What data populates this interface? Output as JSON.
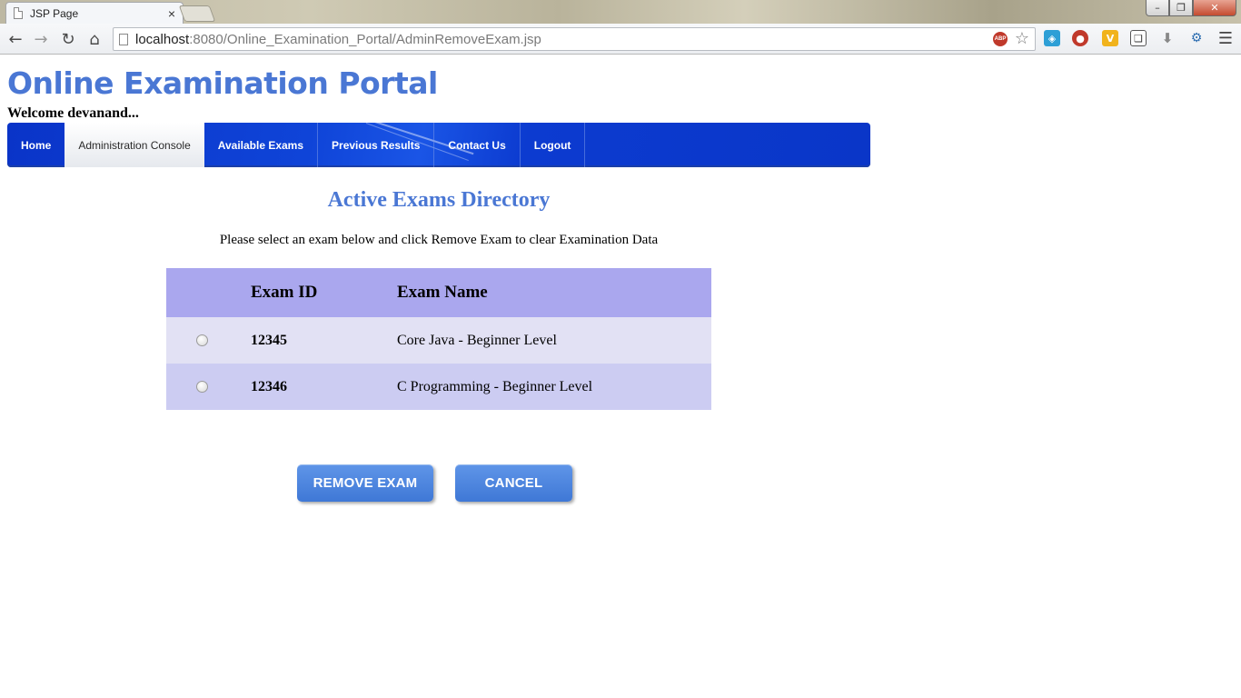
{
  "browser": {
    "tab_title": "JSP Page",
    "tab_close": "×",
    "url_host": "localhost",
    "url_rest": ":8080/Online_Examination_Portal/AdminRemoveExam.jsp",
    "abp_label": "ABP",
    "icons": {
      "back": "back-arrow-icon",
      "forward": "forward-arrow-icon",
      "reload": "reload-icon",
      "home": "home-icon",
      "star": "bookmark-star-icon",
      "menu": "menu-icon"
    }
  },
  "site": {
    "title": "Online Examination Portal",
    "welcome": "Welcome devanand..."
  },
  "nav": {
    "items": [
      {
        "label": "Home"
      },
      {
        "label": "Administration Console"
      },
      {
        "label": "Available Exams"
      },
      {
        "label": "Previous Results"
      },
      {
        "label": "Contact Us"
      },
      {
        "label": "Logout"
      }
    ],
    "active_index": 1
  },
  "main": {
    "heading": "Active Exams Directory",
    "instructions": "Please select an exam below and click Remove Exam to clear Examination Data",
    "table": {
      "headers": [
        "",
        "Exam ID",
        "Exam Name"
      ],
      "rows": [
        {
          "id": "12345",
          "name": "Core Java - Beginner Level",
          "selected": false
        },
        {
          "id": "12346",
          "name": "C Programming - Beginner Level",
          "selected": false
        }
      ]
    },
    "buttons": {
      "remove": "REMOVE EXAM",
      "cancel": "CANCEL"
    }
  },
  "colors": {
    "title_blue": "#4a77d4",
    "menubar_blue": "#0f44d8",
    "table_header": "#aaa7ee",
    "row_light": "#e2e1f4",
    "row_dark": "#ccccf2",
    "button_blue": "#4f86de"
  }
}
